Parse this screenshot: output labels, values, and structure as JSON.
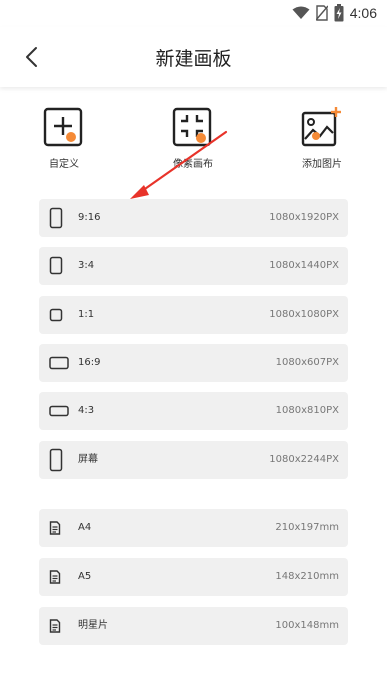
{
  "status": {
    "time": "4:06",
    "icons": [
      "wifi-icon",
      "no-sim-icon",
      "battery-charging-icon"
    ]
  },
  "header": {
    "title": "新建画板",
    "back_icon": "chevron-left-icon"
  },
  "tools": [
    {
      "name": "custom",
      "label": "自定义",
      "icon": "plus-box-icon"
    },
    {
      "name": "pixel-canvas",
      "label": "像素画布",
      "icon": "frame-corners-icon"
    },
    {
      "name": "add-image",
      "label": "添加图片",
      "icon": "image-plus-icon"
    }
  ],
  "presets": [
    {
      "label": "9:16",
      "size": "1080x1920PX",
      "icon": "portrait-tall-icon"
    },
    {
      "label": "3:4",
      "size": "1080x1440PX",
      "icon": "portrait-icon"
    },
    {
      "label": "1:1",
      "size": "1080x1080PX",
      "icon": "square-icon"
    },
    {
      "label": "16:9",
      "size": "1080x607PX",
      "icon": "landscape-wide-icon"
    },
    {
      "label": "4:3",
      "size": "1080x810PX",
      "icon": "landscape-icon"
    },
    {
      "label": "屏幕",
      "size": "1080x2244PX",
      "icon": "phone-screen-icon"
    },
    {
      "label": "A4",
      "size": "210x197mm",
      "icon": "document-icon"
    },
    {
      "label": "A5",
      "size": "148x210mm",
      "icon": "document-icon"
    },
    {
      "label": "明星片",
      "size": "100x148mm",
      "icon": "document-icon"
    }
  ],
  "colors": {
    "accent": "#f58a36",
    "arrow": "#e8332a",
    "row_bg": "#f0f0f0"
  }
}
